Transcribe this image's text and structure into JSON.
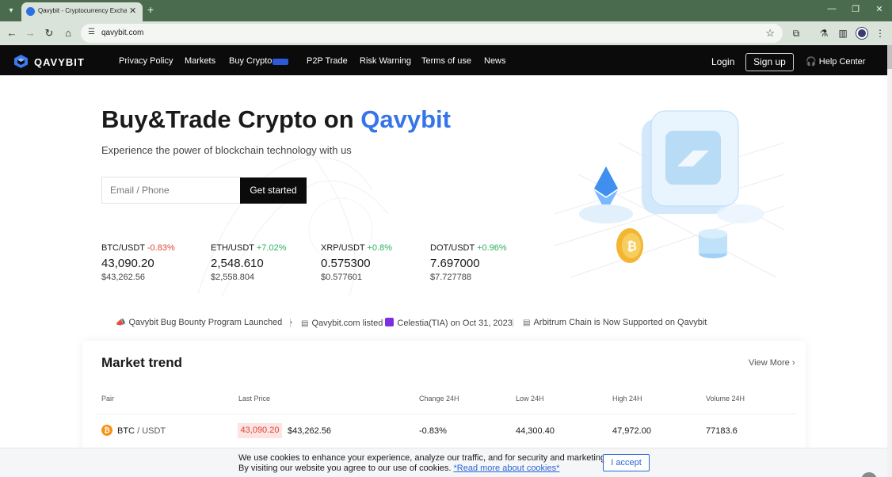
{
  "browser": {
    "tab_title": "Qavybit - Cryptocurrency Exchange",
    "url": "qavybit.com"
  },
  "header": {
    "logo": "QAVYBIT",
    "nav": [
      "Privacy Policy",
      "Markets",
      "Buy Crypto",
      "P2P Trade",
      "Risk Warning",
      "Terms of use",
      "News"
    ],
    "login": "Login",
    "signup": "Sign up",
    "help": "Help Center"
  },
  "hero": {
    "title_prefix": "Buy&Trade Crypto on ",
    "title_accent": "Qavybit",
    "subtitle": "Experience the power of blockchain technology with us",
    "email_placeholder": "Email / Phone",
    "cta": "Get started"
  },
  "tickers": [
    {
      "pair": "BTC/USDT",
      "change": "-0.83%",
      "price": "43,090.20",
      "usd": "$43,262.56"
    },
    {
      "pair": "ETH/USDT",
      "change": "+7.02%",
      "price": "2,548.610",
      "usd": "$2,558.804"
    },
    {
      "pair": "XRP/USDT",
      "change": "+0.8%",
      "price": "0.575300",
      "usd": "$0.577601"
    },
    {
      "pair": "DOT/USDT",
      "change": "+0.96%",
      "price": "7.697000",
      "usd": "$7.727788"
    }
  ],
  "announcements": {
    "item1": "Qavybit Bug Bounty Program Launched",
    "item2_a": "Qavybit.com listed",
    "item2_b": "Celestia(TIA) on Oct 31, 2023",
    "item3": "Arbitrum Chain is Now Supported on Qavybit"
  },
  "market": {
    "title": "Market trend",
    "view_more": "View More",
    "columns": [
      "Pair",
      "Last Price",
      "Change 24H",
      "Low 24H",
      "High 24H",
      "Volume 24H"
    ],
    "rows": [
      {
        "base": "BTC",
        "quote": "USDT",
        "last": "43,090.20",
        "usd": "$43,262.56",
        "change": "-0.83%",
        "low": "44,300.40",
        "high": "47,972.00",
        "volume": "77183.6"
      }
    ]
  },
  "cookie": {
    "line1": "We use cookies to enhance your experience, analyze our traffic, and for security and marketing.",
    "line2": "By visiting our website you agree to our use of cookies.",
    "link": "*Read more about cookies*",
    "accept": "I accept"
  },
  "colors": {
    "accent": "#3574ea",
    "down": "#e0473a",
    "up": "#2fb15c",
    "header_bg": "#0b0b0b",
    "chrome": "#4b6b4f"
  }
}
